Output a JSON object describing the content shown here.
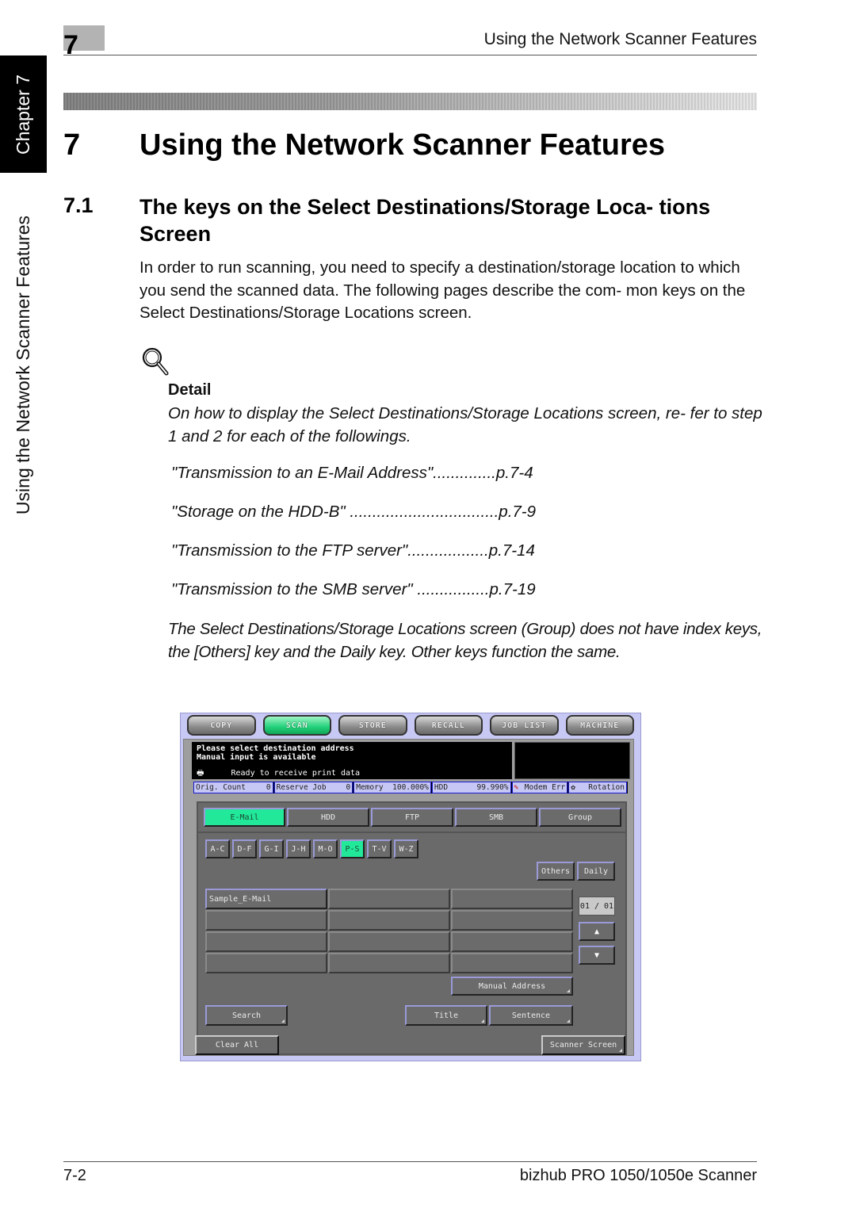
{
  "header": {
    "chapter_number": "7",
    "running_title": "Using the Network Scanner Features"
  },
  "side_tab": {
    "chapter_label": "Chapter 7",
    "section_label": "Using the Network Scanner Features"
  },
  "chapter_heading": {
    "number": "7",
    "title": "Using the Network Scanner Features"
  },
  "section_heading": {
    "number": "7.1",
    "title": "The keys on the Select Destinations/Storage Loca- tions Screen"
  },
  "intro_paragraph": "In order to run scanning, you need to specify a destination/storage location to which you send the scanned data. The following pages describe the com- mon keys on the Select Destinations/Storage Locations screen.",
  "detail": {
    "icon": "magnifier-icon",
    "label": "Detail",
    "text": "On how to display the Select Destinations/Storage Locations screen, re- fer to step 1 and 2 for each of the followings.",
    "references": [
      {
        "text": "\"Transmission to an E-Mail Address\"..............p.7-4"
      },
      {
        "text": "\"Storage on the HDD-B\" .................................p.7-9"
      },
      {
        "text": "\"Transmission to the FTP server\"..................p.7-14"
      },
      {
        "text": "\"Transmission to the SMB server\" ................p.7-19"
      }
    ],
    "note": "The Select Destinations/Storage Locations screen (Group) does not have index keys, the [Others] key and the Daily key. Other keys function the same."
  },
  "device_screen": {
    "mode_tabs": [
      {
        "label": "COPY",
        "active": false
      },
      {
        "label": "SCAN",
        "active": true
      },
      {
        "label": "STORE",
        "active": false
      },
      {
        "label": "RECALL",
        "active": false
      },
      {
        "label": "JOB LIST",
        "active": false
      },
      {
        "label": "MACHINE",
        "active": false
      }
    ],
    "message_line1": "Please select destination address",
    "message_line2": "Manual input is available",
    "printer_icon": "printer-icon",
    "ready_text": "Ready to receive print data",
    "status_bar": {
      "orig_count_label": "Orig. Count",
      "orig_count_value": "0",
      "reserve_job_label": "Reserve Job",
      "reserve_job_value": "0",
      "memory_label": "Memory",
      "memory_value": "100.000%",
      "hdd_label": "HDD",
      "hdd_value": "99.990%",
      "modem_label": "Modem Err",
      "rotation_label": "Rotation"
    },
    "destination_tabs": [
      {
        "label": "E-Mail",
        "active": true
      },
      {
        "label": "HDD",
        "active": false
      },
      {
        "label": "FTP",
        "active": false
      },
      {
        "label": "SMB",
        "active": false
      },
      {
        "label": "Group",
        "active": false
      }
    ],
    "index_keys": [
      {
        "label": "A-C",
        "active": false
      },
      {
        "label": "D-F",
        "active": false
      },
      {
        "label": "G-I",
        "active": false
      },
      {
        "label": "J-H",
        "active": false
      },
      {
        "label": "M-O",
        "active": false
      },
      {
        "label": "P-S",
        "active": true
      },
      {
        "label": "T-V",
        "active": false
      },
      {
        "label": "W-Z",
        "active": false
      }
    ],
    "others_label": "Others",
    "daily_label": "Daily",
    "address_entries": [
      "Sample_E-Mail",
      "",
      "",
      "",
      "",
      "",
      "",
      "",
      "",
      "",
      "",
      ""
    ],
    "page_indicator": "01 / 01",
    "scroll_up_icon": "triangle-up-icon",
    "scroll_down_icon": "triangle-down-icon",
    "manual_address_label": "Manual Address",
    "search_label": "Search",
    "title_label": "Title",
    "sentence_label": "Sentence",
    "clear_all_label": "Clear All",
    "scanner_screen_label": "Scanner Screen"
  },
  "footer": {
    "page_number": "7-2",
    "product_name": "bizhub PRO 1050/1050e Scanner"
  }
}
